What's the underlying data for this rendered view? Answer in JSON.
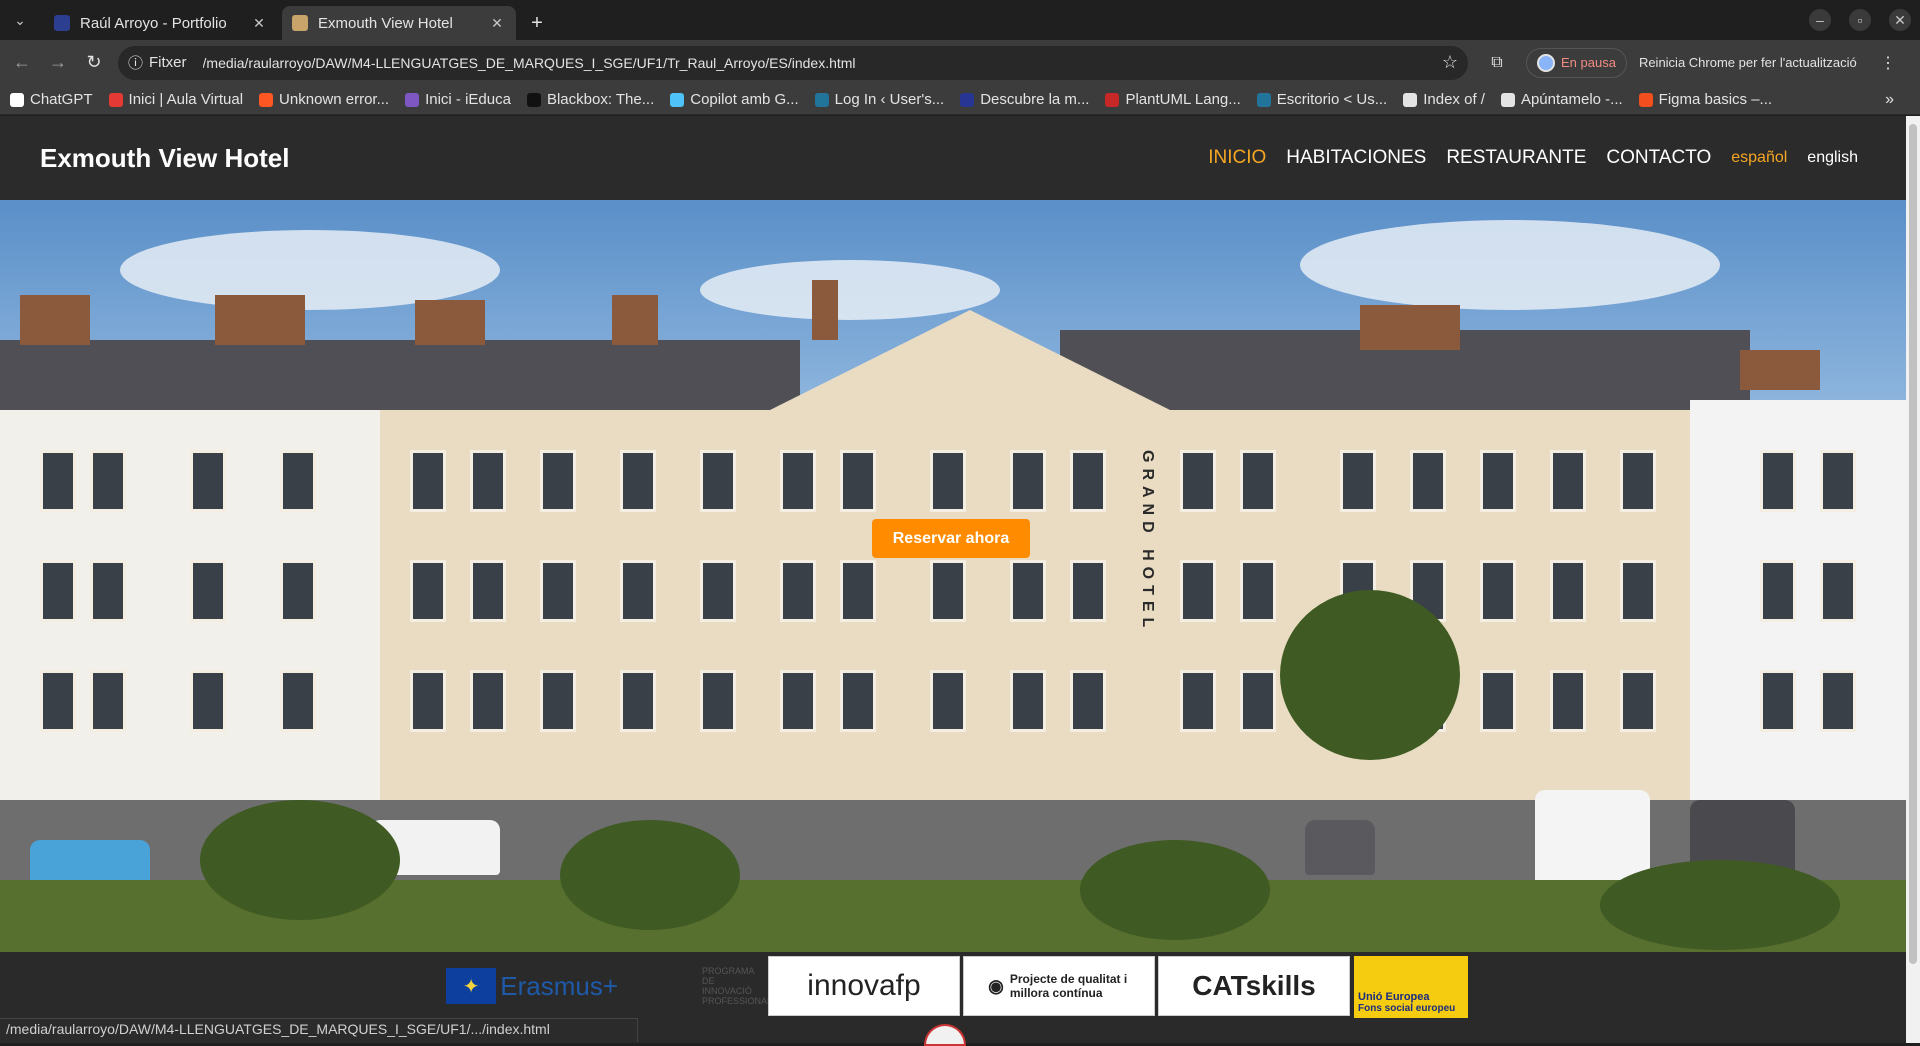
{
  "browser": {
    "tabs": [
      {
        "title": "Raúl Arroyo - Portfolio",
        "active": false
      },
      {
        "title": "Exmouth View Hotel",
        "active": true
      }
    ],
    "address_chip": "Fitxer",
    "url": "/media/raularroyo/DAW/M4-LLENGUATGES_DE_MARQUES_I_SGE/UF1/Tr_Raul_Arroyo/ES/index.html",
    "profile_status": "En pausa",
    "update_label": "Reinicia Chrome per fer l'actualització",
    "bookmarks": [
      {
        "label": "ChatGPT",
        "color": "#ffffff"
      },
      {
        "label": "Inici | Aula Virtual",
        "color": "#e53935"
      },
      {
        "label": "Unknown error...",
        "color": "#ff5722"
      },
      {
        "label": "Inici - iEduca",
        "color": "#7e57c2"
      },
      {
        "label": "Blackbox: The...",
        "color": "#111111"
      },
      {
        "label": "Copilot amb G...",
        "color": "#4fc3f7"
      },
      {
        "label": "Log In ‹ User's...",
        "color": "#21759b"
      },
      {
        "label": "Descubre la m...",
        "color": "#283593"
      },
      {
        "label": "PlantUML Lang...",
        "color": "#c62828"
      },
      {
        "label": "Escritorio < Us...",
        "color": "#21759b"
      },
      {
        "label": "Index of /",
        "color": "#e3e3e3"
      },
      {
        "label": "Apúntamelo -...",
        "color": "#e3e3e3"
      },
      {
        "label": "Figma basics –...",
        "color": "#f24e1e"
      }
    ],
    "status_url": "/media/raularroyo/DAW/M4-LLENGUATGES_DE_MARQUES_I_SGE/UF1/.../index.html"
  },
  "site": {
    "title": "Exmouth View Hotel",
    "nav": [
      {
        "label": "INICIO",
        "active": true
      },
      {
        "label": "HABITACIONES",
        "active": false
      },
      {
        "label": "RESTAURANTE",
        "active": false
      },
      {
        "label": "CONTACTO",
        "active": false
      }
    ],
    "languages": [
      {
        "label": "español",
        "active": true
      },
      {
        "label": "english",
        "active": false
      }
    ],
    "hero_sign": "GRAND HOTEL",
    "cta_label": "Reservar ahora",
    "accent_color": "#ff8c00",
    "footer_logos": {
      "erasmus": "Erasmus+",
      "fp_program": "PROGRAMA DE INNOVACIÓ PROFESSIONAL",
      "innova": "innovafp",
      "quality": "Projecte de qualitat i millora contínua",
      "catskills": "CATskills",
      "ue_title": "Unió Europea",
      "ue_sub": "Fons social europeu"
    }
  }
}
